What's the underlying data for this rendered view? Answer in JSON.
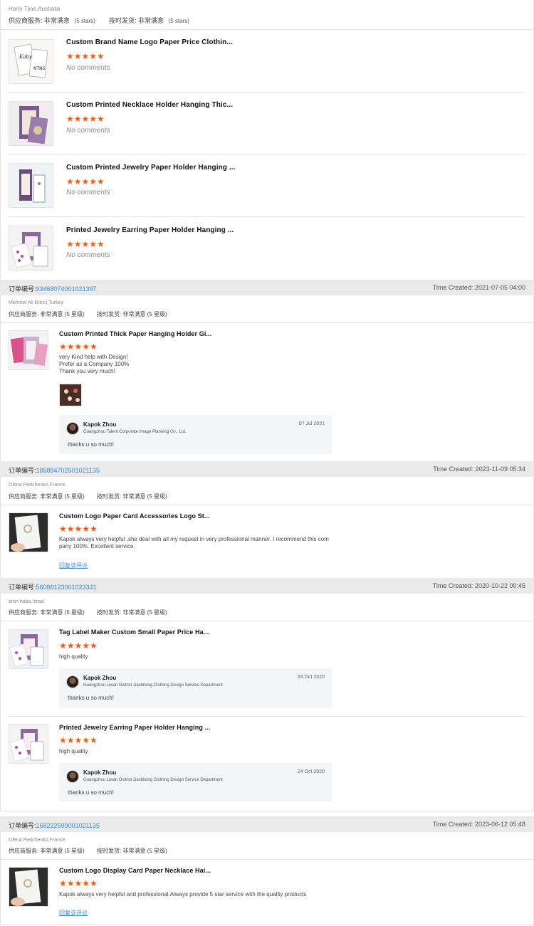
{
  "top_review": {
    "buyer": "Harry Tjioe,Australia",
    "svc_label": "供应商服务:",
    "svc_value": "非常满意",
    "svc_stars": "(5 stars)",
    "ship_label": "按时发货:",
    "ship_value": "非常满意",
    "ship_stars": "(5 stars)",
    "products": [
      {
        "title": "Custom Brand Name Logo Paper Price Clothin...",
        "comment": "No comments"
      },
      {
        "title": "Custom Printed Necklace Holder Hanging Thic...",
        "comment": "No comments"
      },
      {
        "title": "Custom Printed Jewelry Paper Holder Hanging ...",
        "comment": "No comments"
      },
      {
        "title": "Printed Jewelry Earring Paper Holder Hanging ...",
        "comment": "No comments"
      }
    ]
  },
  "orders": [
    {
      "order_label": "订单编号:",
      "order_no": "93468074001021397",
      "time": "Time Created: 2021-07-05 04:00",
      "buyer": "Mehmet Ali Brinci,Turkey",
      "svc": "供应商服务: 非常满意 (5 星级)",
      "ship": "按时发货: 非常满意 (5 星级)",
      "items": [
        {
          "title": "Custom Printed Thick Paper Hanging Holder Gi...",
          "comment": [
            "very Kind help with Design!",
            "Prefer as a Company 100%",
            "Thank you very much!"
          ],
          "reply": {
            "name": "Kapok Zhou",
            "company": "Guangzhou Talent Corporate Image Planning Co., Ltd.",
            "date": "07 Jul 2021",
            "text": "thanks u so much!"
          }
        }
      ]
    },
    {
      "order_label": "订单编号:",
      "order_no": "185884702501021135",
      "time": "Time Created: 2023-11-09 05:34",
      "buyer": "Olena Pedchenko,France",
      "svc": "供应商服务: 非常满意 (5 星级)",
      "ship": "按时发货: 非常满意 (5 星级)",
      "items": [
        {
          "title": "Custom Logo Paper Card Accessories Logo St...",
          "comment": [
            "Kapok always very helpful ,she deal with all my request in very professional manner. I recommend this com",
            "pany 100%. Excellent service."
          ],
          "link": "回复该评论"
        }
      ]
    },
    {
      "order_label": "订单编号:",
      "order_no": "56088123001023341",
      "time": "Time Created: 2020-10-22 00:45",
      "buyer": "eran haba,Israel",
      "svc": "供应商服务: 非常满意 (5 星级)",
      "ship": "按时发货: 非常满意 (5 星级)",
      "items": [
        {
          "title": "Tag Label Maker Custom Small Paper Price Ha...",
          "comment": [
            "high quality"
          ],
          "reply": {
            "name": "Kapok Zhou",
            "company": "Guangzhou Liwan District Jiashitang Clothing Design Service Department",
            "date": "24 Oct 2020",
            "text": "thanks u so much!"
          }
        },
        {
          "title": "Printed Jewelry Earring Paper Holder Hanging ...",
          "comment": [
            "high quality"
          ],
          "reply": {
            "name": "Kapok Zhou",
            "company": "Guangzhou Liwan District Jiashitang Clothing Design Service Department",
            "date": "24 Oct 2020",
            "text": "thanks u so much!"
          }
        }
      ]
    },
    {
      "order_label": "订单编号:",
      "order_no": "168222599001021135",
      "time": "Time Created: 2023-06-12 05:48",
      "buyer": "Olena Pedchenko,France",
      "svc": "供应商服务: 非常满意 (5 星级)",
      "ship": "按时发货: 非常满意 (5 星级)",
      "items": [
        {
          "title": "Custom Logo Display Card Paper Necklace Hai...",
          "comment": [
            "Kapok always very helpful and professional.Always provide 5 star service with the quality products"
          ],
          "link": "回复该评论"
        }
      ]
    }
  ],
  "star_glyphs": "★★★★★",
  "colors": {
    "star": "#f05a14",
    "link": "#3b8bd4",
    "order_bar": "#eaeaea"
  }
}
